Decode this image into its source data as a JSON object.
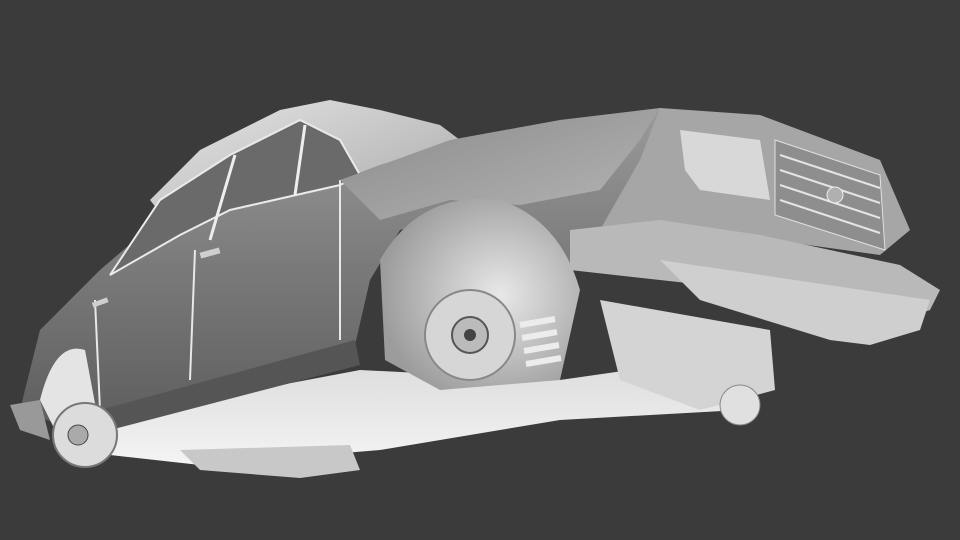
{
  "viewport": {
    "background_color": "#3b3b3b",
    "model_base_color": "#bdbdbd",
    "model_highlight_color": "#f2f2f2",
    "model_shadow_color": "#5a5a5a"
  }
}
